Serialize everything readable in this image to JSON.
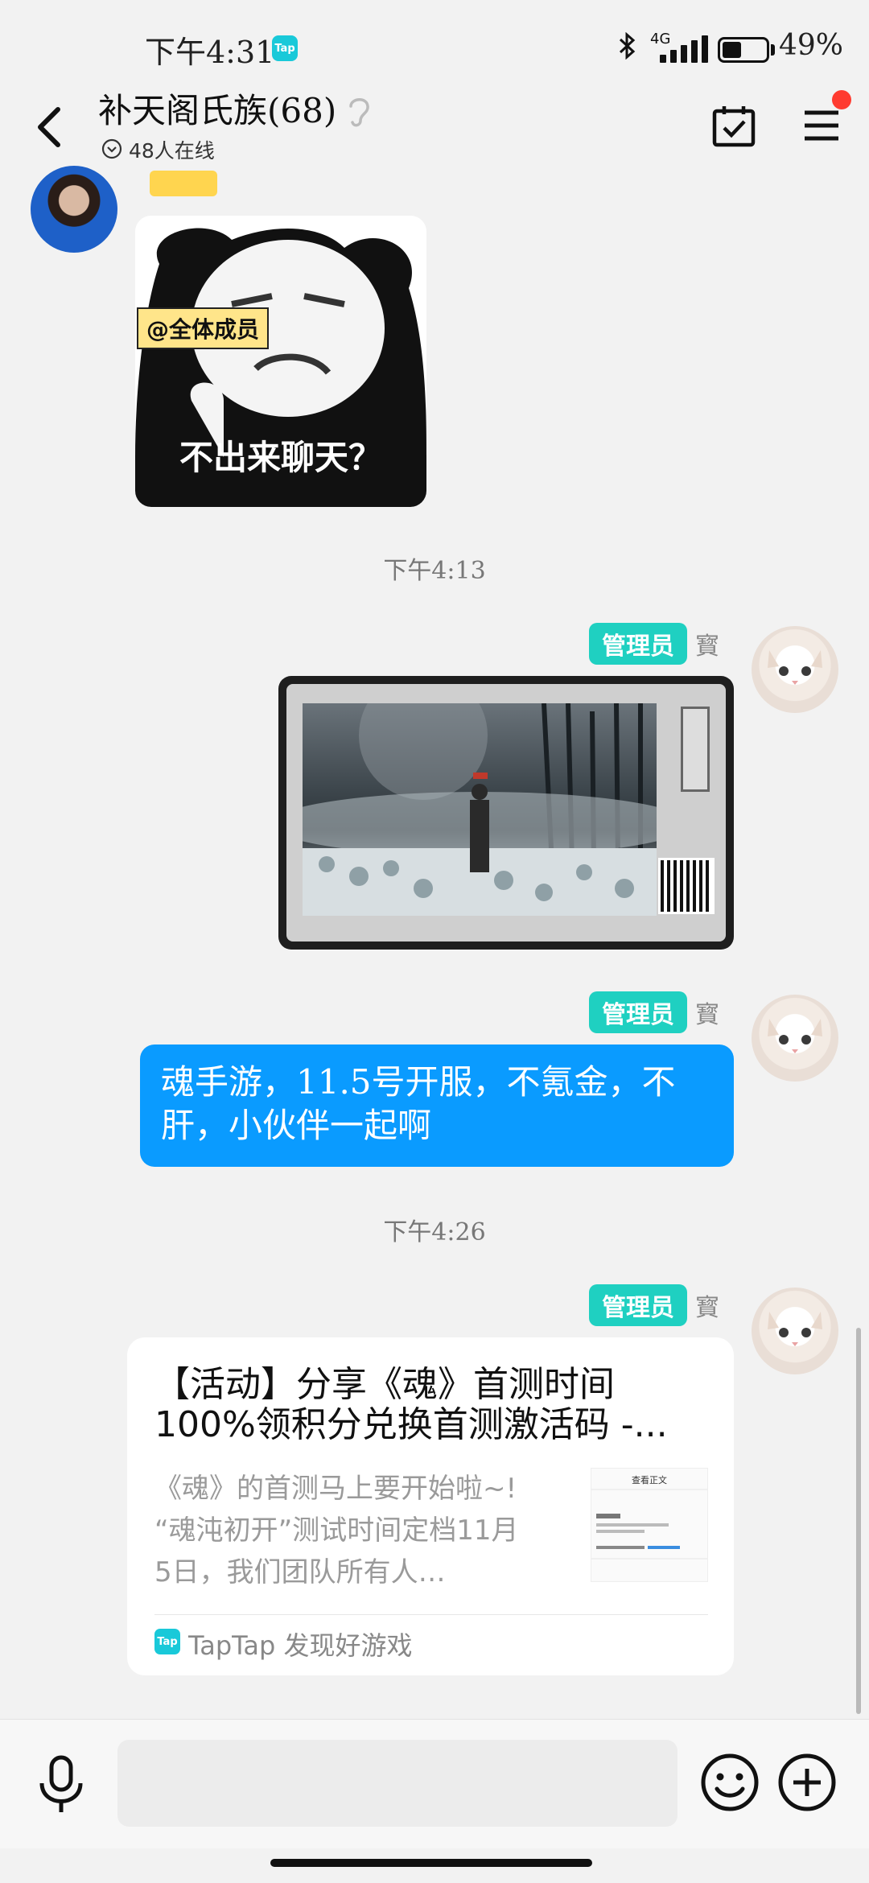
{
  "status_bar": {
    "time": "下午4:31",
    "app_badge": "Tap",
    "network": "4G",
    "battery": "49%",
    "battery_level": 0.45
  },
  "header": {
    "title": "补天阁氏族(68)",
    "online_count": "48人在线",
    "has_notification": true
  },
  "messages": [
    {
      "type": "image",
      "sender": "other",
      "meme_label": "@全体成员",
      "meme_caption": "不出来聊天？"
    },
    {
      "type": "time",
      "text": "下午4:13"
    },
    {
      "type": "image",
      "sender": "self",
      "role_badge": "管理员",
      "sender_name": "寳"
    },
    {
      "type": "text",
      "sender": "self",
      "role_badge": "管理员",
      "sender_name": "寳",
      "text": "魂手游，11.5号开服，不氪金，不肝，小伙伴一起啊"
    },
    {
      "type": "time",
      "text": "下午4:26"
    },
    {
      "type": "share_card",
      "sender": "self",
      "role_badge": "管理员",
      "sender_name": "寳",
      "title_line1": "【活动】分享《魂》首测时间",
      "title_line2": "100%领积分兑换首测激活码 -...",
      "description": "《魂》的首测马上要开始啦~!\n“魂沌初开”测试时间定档11月5日，我们团队所有人…",
      "thumb_title": "查看正文",
      "source_icon": "Tap",
      "source": "TapTap 发现好游戏"
    }
  ],
  "input_bar": {
    "placeholder": ""
  },
  "colors": {
    "accent_blue": "#0a9bff",
    "role_badge": "#1fd0c1",
    "notification": "#ff3b30"
  },
  "icons": [
    "back-arrow-icon",
    "ear-icon",
    "online-status-icon",
    "calendar-check-icon",
    "menu-icon",
    "microphone-icon",
    "emoji-icon",
    "plus-icon"
  ]
}
